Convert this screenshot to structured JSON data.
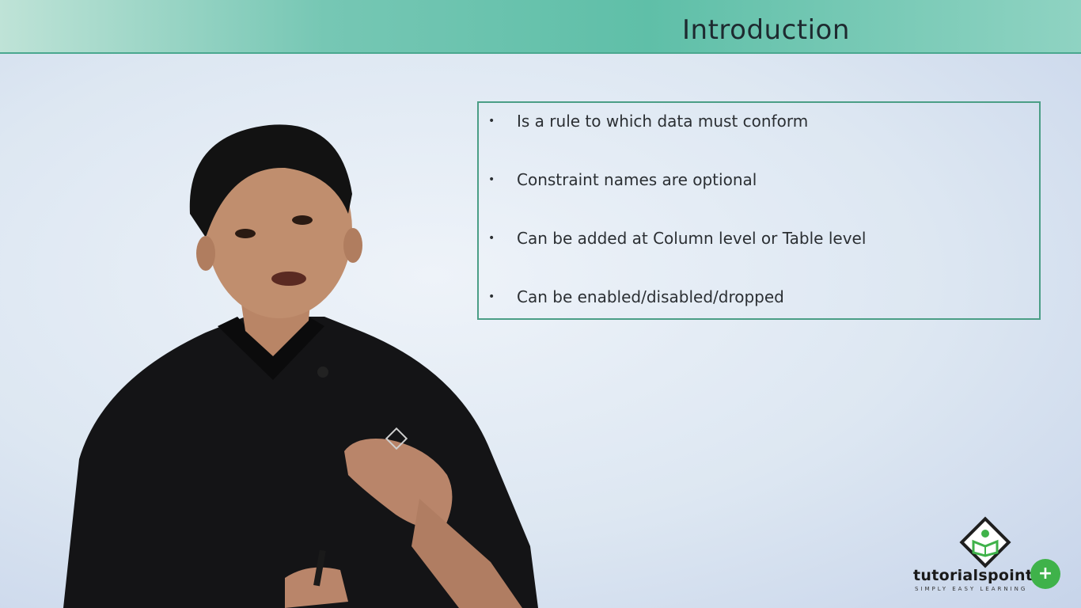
{
  "slide": {
    "title": "Introduction",
    "bullets": [
      "Is a rule to which data must conform",
      "Constraint names are optional",
      "Can be added at Column level or Table level",
      "Can be enabled/disabled/dropped"
    ],
    "bullet_glyph": "•"
  },
  "logo": {
    "word": "tutorialspoint",
    "tagline": "SIMPLY EASY LEARNING",
    "badge": "+"
  },
  "colors": {
    "header": "#5fbfa8",
    "box_border": "#4b9e86",
    "badge": "#3fb24a"
  }
}
